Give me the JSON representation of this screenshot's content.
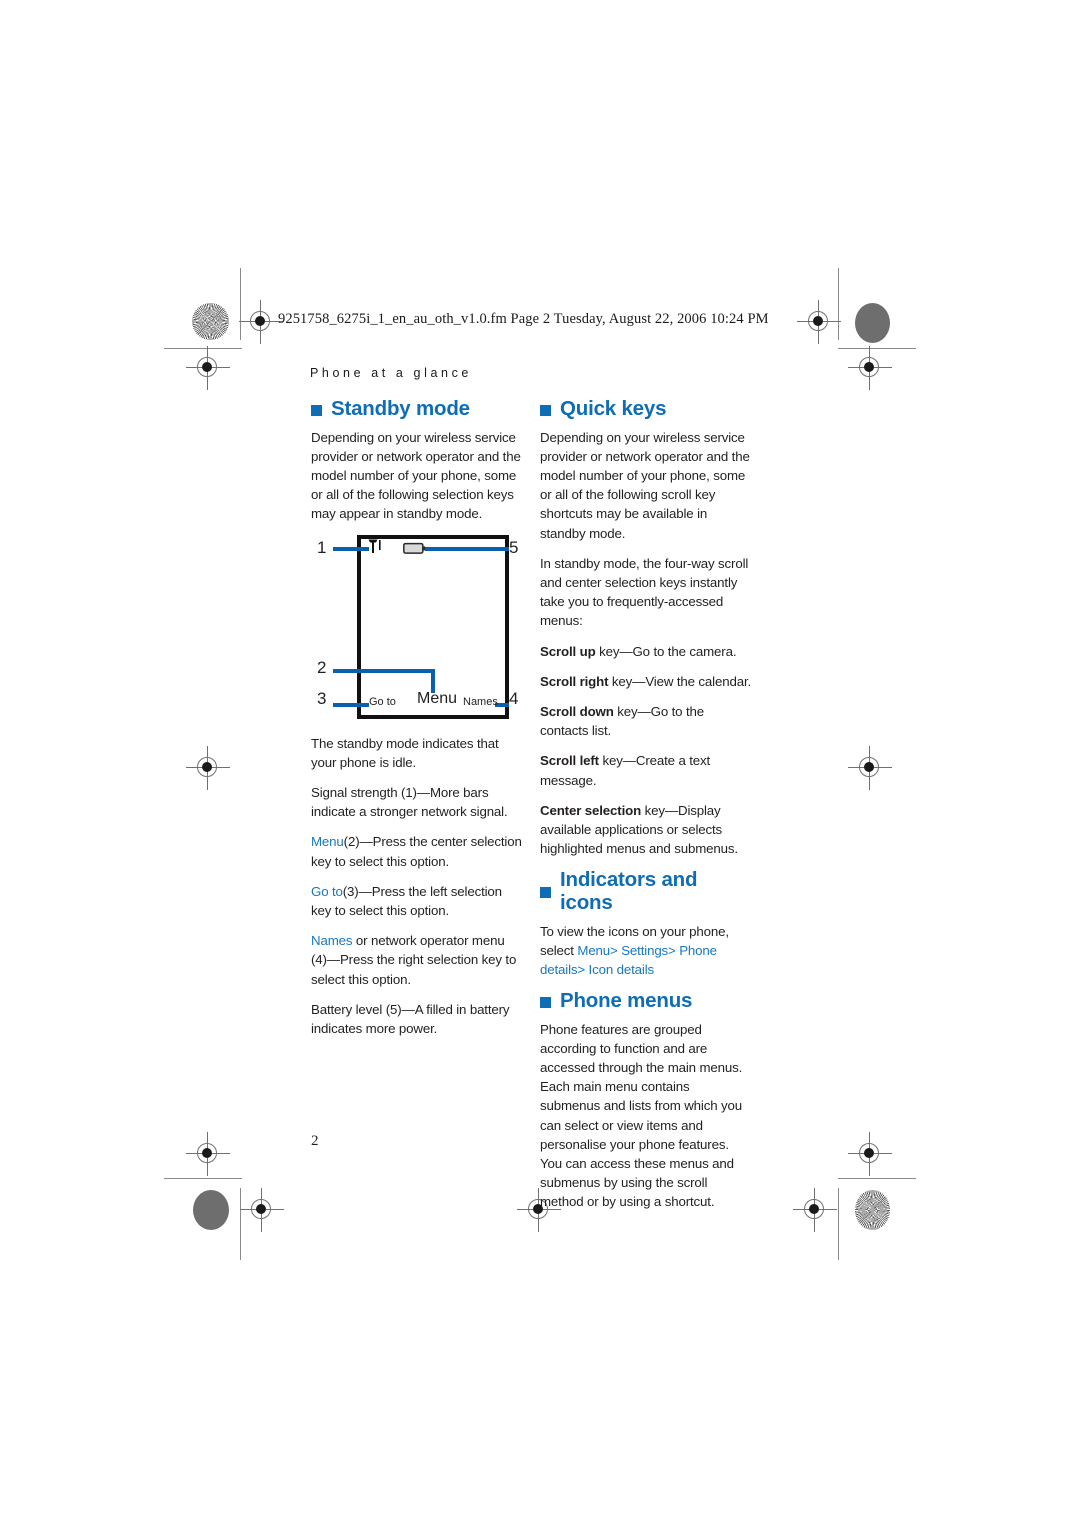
{
  "document": {
    "filename_line": "9251758_6275i_1_en_au_oth_v1.0.fm  Page 2  Tuesday, August 22, 2006  10:24 PM",
    "chapter_header": "Phone at a glance",
    "page_number": "2",
    "accent_color": "#0E6DB5",
    "ui_link_color": "#1878BE",
    "leader_color": "#0B5FAF",
    "text_color": "#231f20"
  },
  "left_column": {
    "standby": {
      "heading": "Standby mode",
      "intro": "Depending on your wireless service provider or network operator and the model number of your phone, some or all of the following selection keys may appear in standby mode."
    },
    "figure": {
      "name": "standby-screen-diagram",
      "callouts": [
        "1",
        "2",
        "3",
        "4",
        "5"
      ],
      "softkey_left": "Go to",
      "softkey_center": "Menu",
      "softkey_right": "Names",
      "status_icons": [
        "signal-strength-icon",
        "battery-icon"
      ]
    },
    "paragraphs": [
      {
        "id": "standby-idle",
        "plain": "The standby mode indicates that your phone is idle."
      },
      {
        "id": "signal-strength",
        "plain": "Signal strength (1)—More bars indicate a stronger network signal."
      },
      {
        "id": "menu-key",
        "ui": "Menu",
        "rest": "(2)—Press the center selection key to select this option."
      },
      {
        "id": "goto-key",
        "ui": "Go to",
        "rest": "(3)—Press the left selection key to select this option."
      },
      {
        "id": "names-key",
        "ui": "Names",
        "rest": " or network operator menu (4)—Press the right selection key to select this option."
      },
      {
        "id": "battery-level",
        "plain": "Battery level (5)—A filled in battery indicates more power."
      }
    ]
  },
  "right_column": {
    "quick_keys": {
      "heading": "Quick keys",
      "intro": "Depending on your wireless service provider or network operator and the model number of your phone, some or all of the following scroll key shortcuts may be available in standby mode.",
      "body": "In standby mode, the four-way scroll and center selection keys instantly take you to frequently-accessed menus:",
      "items": [
        {
          "key": "Scroll up",
          "desc": " key—Go to the camera."
        },
        {
          "key": "Scroll right",
          "desc": " key—View the calendar."
        },
        {
          "key": "Scroll down",
          "desc": " key—Go to the contacts list."
        },
        {
          "key": "Scroll left",
          "desc": " key—Create a text message."
        },
        {
          "key": "Center selection",
          "desc": " key—Display available applications or selects highlighted menus and submenus."
        }
      ]
    },
    "indicators": {
      "heading": "Indicators and icons",
      "lead": "To view the icons on your phone, select ",
      "path": "Menu> Settings> Phone details> Icon details"
    },
    "phone_menus": {
      "heading": "Phone menus",
      "para1": "Phone features are grouped according to function and are accessed through the main menus. Each main menu contains submenus and lists from which you can select or view items and personalise your phone features.",
      "para2": "You can access these menus and submenus by using the scroll method or by using a shortcut."
    }
  }
}
